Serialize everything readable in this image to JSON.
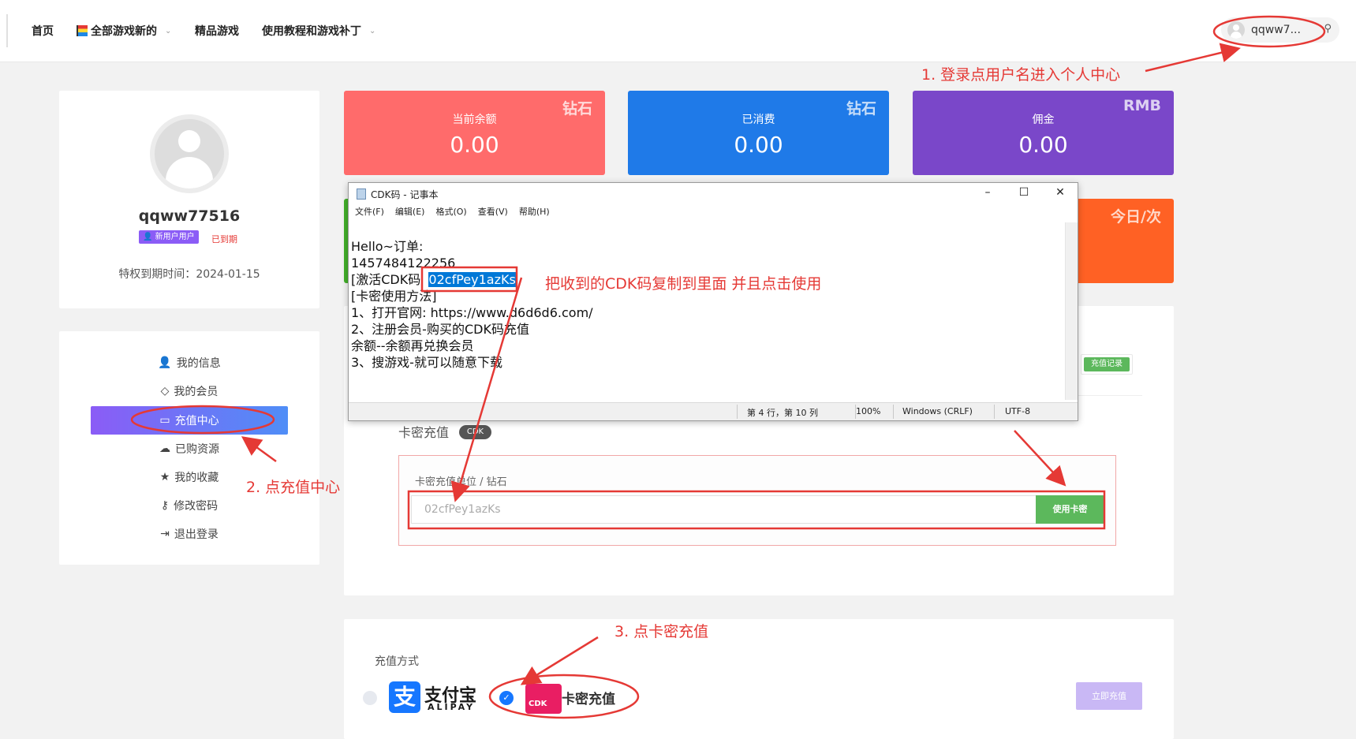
{
  "nav": {
    "home": "首页",
    "all_games": "全部游戏新的",
    "featured": "精品游戏",
    "tutorials": "使用教程和游戏补丁",
    "username_short": "qqww7..."
  },
  "profile": {
    "username": "qqww77516",
    "badge": "新用户用户",
    "status": "已到期",
    "expire_label": "特权到期时间：",
    "expire_date": "2024-01-15"
  },
  "menu": {
    "items": [
      "我的信息",
      "我的会员",
      "充值中心",
      "已购资源",
      "我的收藏",
      "修改密码",
      "退出登录"
    ]
  },
  "stats": [
    {
      "label": "当前余额",
      "value": "0.00",
      "unit": "钻石",
      "color": "#ff6b6b"
    },
    {
      "label": "已消费",
      "value": "0.00",
      "unit": "钻石",
      "color": "#1f7ae8"
    },
    {
      "label": "佣金",
      "value": "0.00",
      "unit": "RMB",
      "color": "#7a47c9"
    }
  ],
  "partial_card": {
    "unit": "今日/次",
    "color": "#ff6124"
  },
  "notepad": {
    "title": "CDK码 - 记事本",
    "menus": [
      "文件(F)",
      "编辑(E)",
      "格式(O)",
      "查看(V)",
      "帮助(H)"
    ],
    "lines": {
      "l1": "Hello~订单:",
      "l2": "1457484122256",
      "l3_prefix": "[激活CDK码  ",
      "l3_code": "02cfPey1azKs",
      "l4": "[卡密使用方法]",
      "l5": "1、打开官网: https://www.d6d6d6.com/",
      "l6": "2、注册会员-购买的CDK码充值",
      "l7": "余额--余额再兑换会员",
      "l8": "3、搜游戏-就可以随意下载"
    },
    "status": {
      "position": "第 4 行，第 10 列",
      "zoom": "100%",
      "eol": "Windows (CRLF)",
      "encoding": "UTF-8"
    }
  },
  "recharge": {
    "record_button": "充值记录",
    "card_title": "卡密充值",
    "card_pill": "CDK",
    "unit_label": "卡密充值单位 / 钻石",
    "input_value": "02cfPey1azKs",
    "use_button": "使用卡密"
  },
  "payment": {
    "label": "充值方式",
    "alipay_zh": "支付宝",
    "alipay_en": "ALIPAY",
    "cdk_logo": "CDK",
    "cdk_label": "卡密充值",
    "now_button": "立即充值"
  },
  "annotations": {
    "step1": "1. 登录点用户名进入个人中心",
    "step2": "2. 点充值中心",
    "step3": "3. 点卡密充值",
    "copy_hint": "把收到的CDK码复制到里面 并且点击使用"
  }
}
